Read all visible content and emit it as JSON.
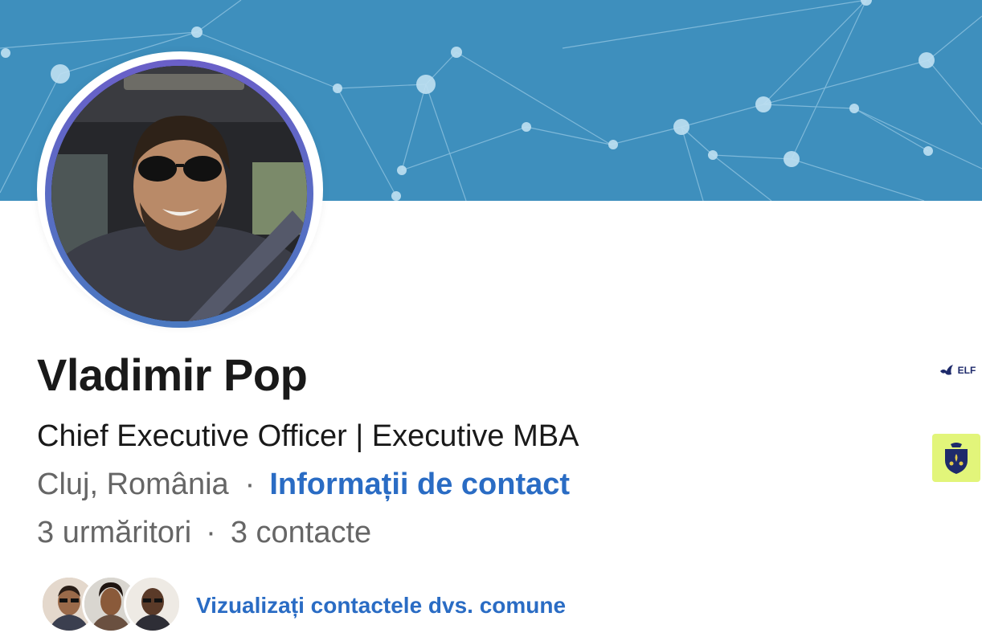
{
  "profile": {
    "name": "Vladimir Pop",
    "headline": "Chief Executive Officer | Executive MBA",
    "location": "Cluj, România",
    "separator": "·",
    "contact_info_label": "Informații de contact",
    "followers": "3 urmăritori",
    "connections": "3 contacte",
    "mutual_connections_label": "Vizualizați contactele dvs. comune"
  },
  "side_logos": {
    "elf_text": "ELF"
  },
  "colors": {
    "banner": "#3e8fbd",
    "link": "#2a6cc4",
    "secondary_text": "#666666",
    "crest_bg": "#e2f57a"
  }
}
